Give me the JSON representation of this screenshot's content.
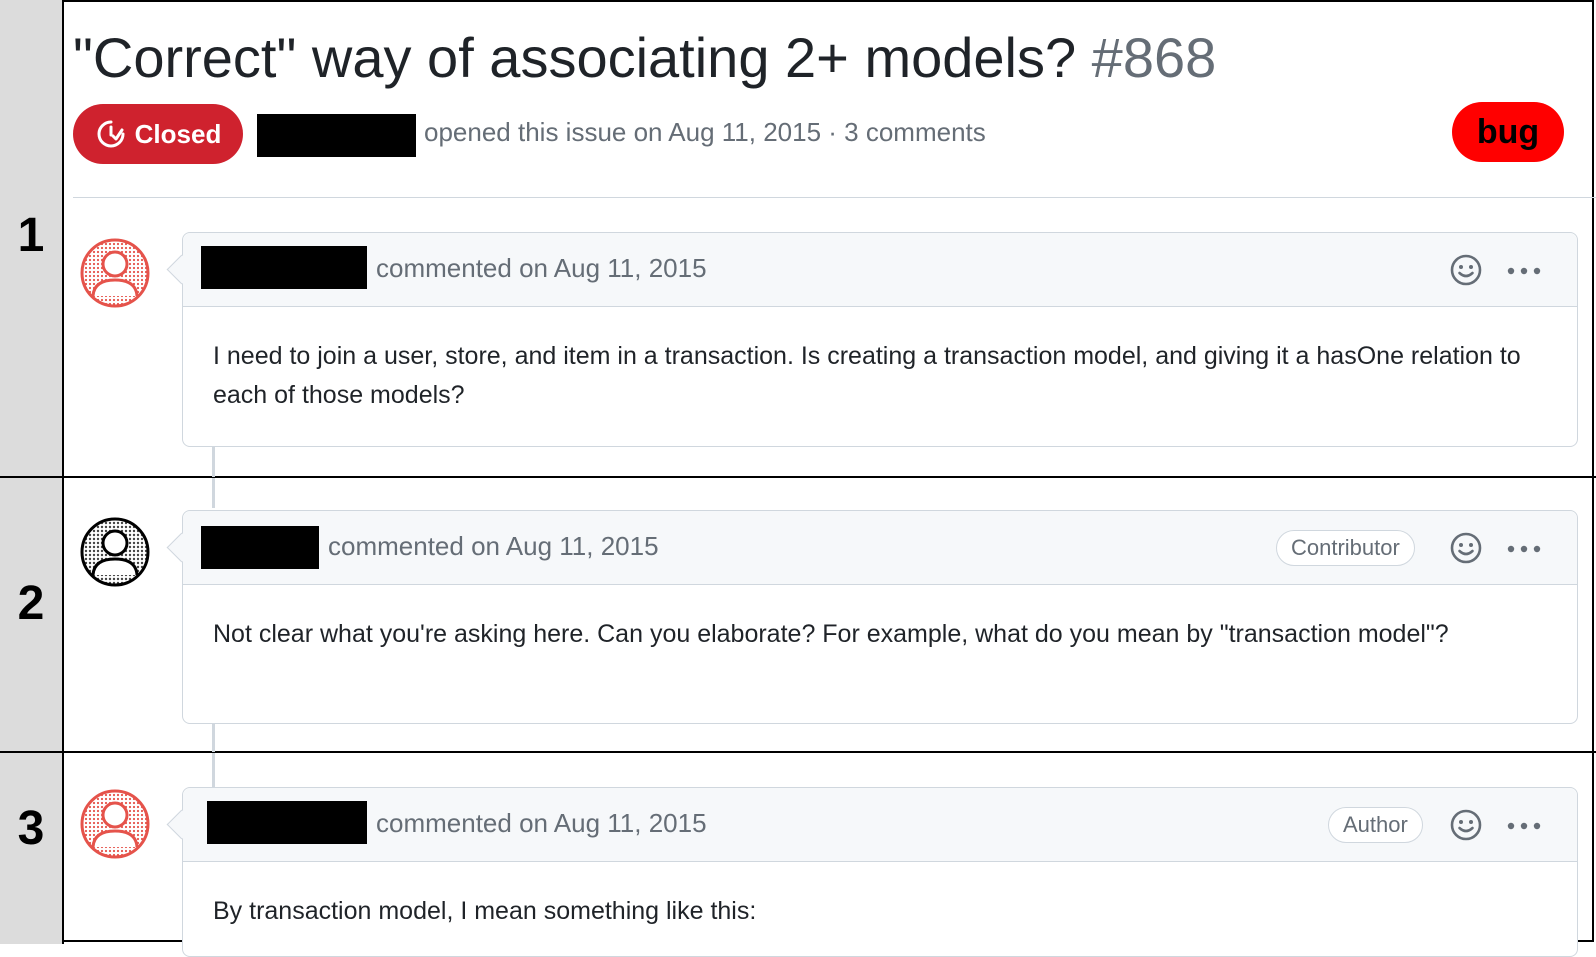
{
  "issue": {
    "title": "\"Correct\" way of associating 2+ models?",
    "number": "#868",
    "state": "Closed",
    "meta": "opened this issue on Aug 11, 2015 · 3 comments",
    "label": "bug"
  },
  "sections": [
    "1",
    "2",
    "3"
  ],
  "comments": [
    {
      "meta": "commented on Aug 11, 2015",
      "role": "",
      "body": "I need to join a user, store, and item in a transaction. Is creating a transaction model, and giving it a hasOne relation to each of those models?"
    },
    {
      "meta": "commented on Aug 11, 2015",
      "role": "Contributor",
      "body": "Not clear what you're asking here. Can you elaborate? For example, what do you mean by \"transaction model\"?"
    },
    {
      "meta": "commented on Aug 11, 2015",
      "role": "Author",
      "body": "By transaction model, I mean something like this:"
    }
  ],
  "colors": {
    "closed": "#cf222e",
    "bug_label": "#ff0000",
    "avatar_author": "#e5534b",
    "avatar_contributor": "#000000"
  },
  "icons": [
    "issue-closed-icon",
    "smiley-icon",
    "kebab-horizontal-icon",
    "user-avatar-icon"
  ]
}
